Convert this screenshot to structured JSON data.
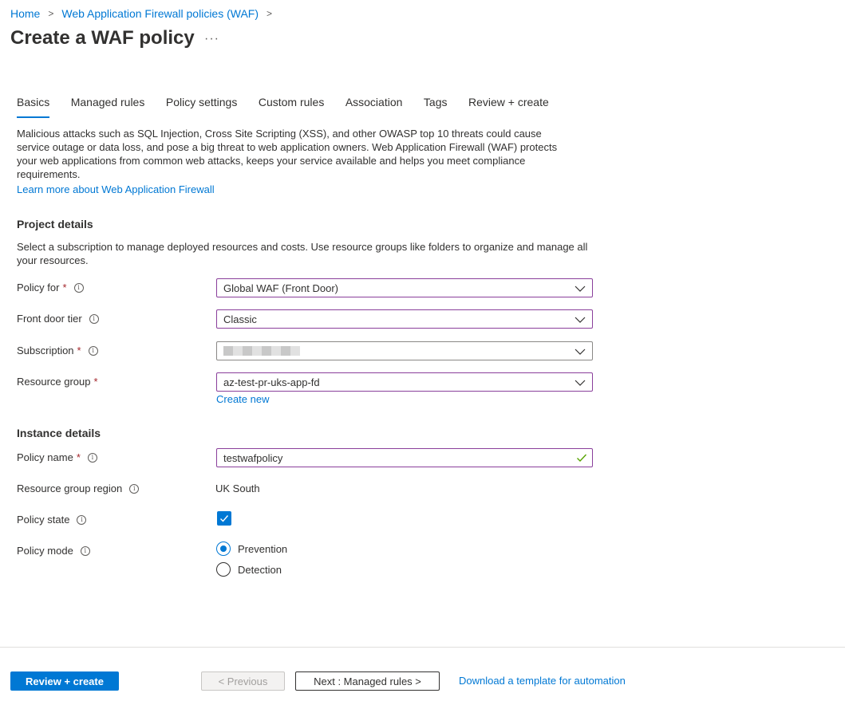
{
  "breadcrumb": {
    "home": "Home",
    "waf_policies": "Web Application Firewall policies (WAF)",
    "separator": ">"
  },
  "page": {
    "title": "Create a WAF policy",
    "more": "···"
  },
  "tabs": [
    "Basics",
    "Managed rules",
    "Policy settings",
    "Custom rules",
    "Association",
    "Tags",
    "Review + create"
  ],
  "active_tab": "Basics",
  "intro": {
    "text": "Malicious attacks such as SQL Injection, Cross Site Scripting (XSS), and other OWASP top 10 threats could cause service outage or data loss, and pose a big threat to web application owners. Web Application Firewall (WAF) protects your web applications from common web attacks, keeps your service available and helps you meet compliance requirements.",
    "learn_more": "Learn more about Web Application Firewall"
  },
  "project_details": {
    "heading": "Project details",
    "description": "Select a subscription to manage deployed resources and costs. Use resource groups like folders to organize and manage all your resources.",
    "policy_for": {
      "label": "Policy for",
      "required": "*",
      "value": "Global WAF (Front Door)"
    },
    "front_door_tier": {
      "label": "Front door tier",
      "value": "Classic"
    },
    "subscription": {
      "label": "Subscription",
      "required": "*",
      "value": ""
    },
    "resource_group": {
      "label": "Resource group",
      "required": "*",
      "value": "az-test-pr-uks-app-fd",
      "create_new": "Create new"
    }
  },
  "instance_details": {
    "heading": "Instance details",
    "policy_name": {
      "label": "Policy name",
      "required": "*",
      "value": "testwafpolicy"
    },
    "resource_group_region": {
      "label": "Resource group region",
      "value": "UK South"
    },
    "policy_state": {
      "label": "Policy state",
      "checked": true
    },
    "policy_mode": {
      "label": "Policy mode",
      "options": [
        "Prevention",
        "Detection"
      ],
      "selected": "Prevention"
    }
  },
  "footer": {
    "review_create": "Review + create",
    "previous": "< Previous",
    "next": "Next : Managed rules >",
    "download_template": "Download a template for automation"
  },
  "colors": {
    "accent": "#0078d4",
    "focus_border": "#8a3f9b",
    "required": "#a4262c",
    "valid": "#57a300"
  },
  "icons": {
    "info": "info-icon",
    "chevron": "chevron-down-icon",
    "valid": "checkmark-icon",
    "more": "more-icon"
  }
}
